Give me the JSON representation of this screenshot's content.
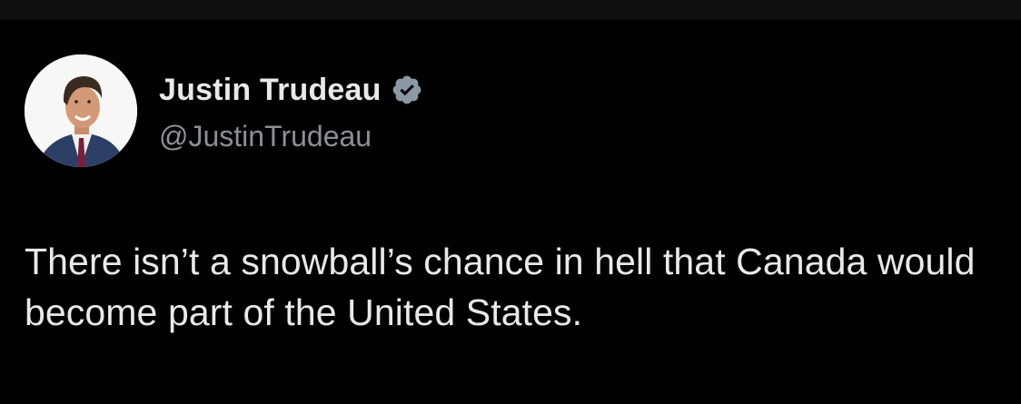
{
  "tweet": {
    "author": {
      "display_name": "Justin Trudeau",
      "handle": "@JustinTrudeau",
      "verified": true,
      "avatar_icon": "profile-photo"
    },
    "text": "There isn’t a snowball’s chance in hell that Canada would become part of the United States."
  },
  "colors": {
    "background": "#000000",
    "text_primary": "#e7e9ea",
    "text_secondary": "#8b9097",
    "verified_badge": "#8b98a5"
  }
}
